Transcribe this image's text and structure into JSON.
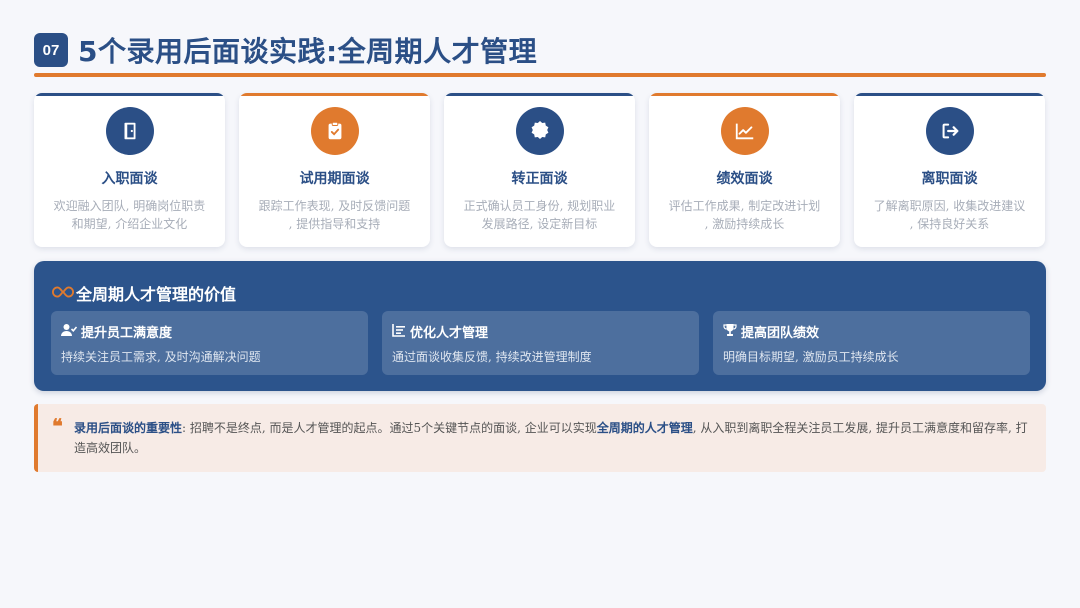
{
  "header": {
    "badge": "07",
    "title": "5个录用后面谈实践:全周期人才管理"
  },
  "colors": {
    "primary": "#2b4f86",
    "accent": "#e07a2e"
  },
  "cards": [
    {
      "icon": "door-exit-icon",
      "color": "blue",
      "title": "入职面谈",
      "desc_line1": "欢迎融入团队, 明确岗位职责",
      "desc_line2": "和期望, 介绍企业文化"
    },
    {
      "icon": "clipboard-check-icon",
      "color": "orange",
      "title": "试用期面谈",
      "desc_line1": "跟踪工作表现, 及时反馈问题",
      "desc_line2": ", 提供指导和支持"
    },
    {
      "icon": "certificate-badge-icon",
      "color": "blue",
      "title": "转正面谈",
      "desc_line1": "正式确认员工身份, 规划职业",
      "desc_line2": "发展路径, 设定新目标"
    },
    {
      "icon": "line-chart-icon",
      "color": "orange",
      "title": "绩效面谈",
      "desc_line1": "评估工作成果, 制定改进计划",
      "desc_line2": ", 激励持续成长"
    },
    {
      "icon": "sign-out-icon",
      "color": "blue",
      "title": "离职面谈",
      "desc_line1": "了解离职原因, 收集改进建议",
      "desc_line2": ", 保持良好关系"
    }
  ],
  "value": {
    "icon": "infinity-icon",
    "title": "全周期人才管理的价值",
    "items": [
      {
        "icon": "user-check-icon",
        "title": "提升员工满意度",
        "desc": "持续关注员工需求, 及时沟通解决问题"
      },
      {
        "icon": "list-sort-icon",
        "title": "优化人才管理",
        "desc": "通过面谈收集反馈, 持续改进管理制度"
      },
      {
        "icon": "trophy-icon",
        "title": "提高团队绩效",
        "desc": "明确目标期望, 激励员工持续成长"
      }
    ]
  },
  "quote": {
    "mark": "❝",
    "lead": "录用后面谈的重要性",
    "text1": ": 招聘不是终点, 而是人才管理的起点。通过5个关键节点的面谈, 企业可以实现",
    "highlight": "全周期的人才管理",
    "text2": ", 从入职到离职全程关注员工发展, 提升员工满意度和留存率, 打造高效团队。"
  }
}
